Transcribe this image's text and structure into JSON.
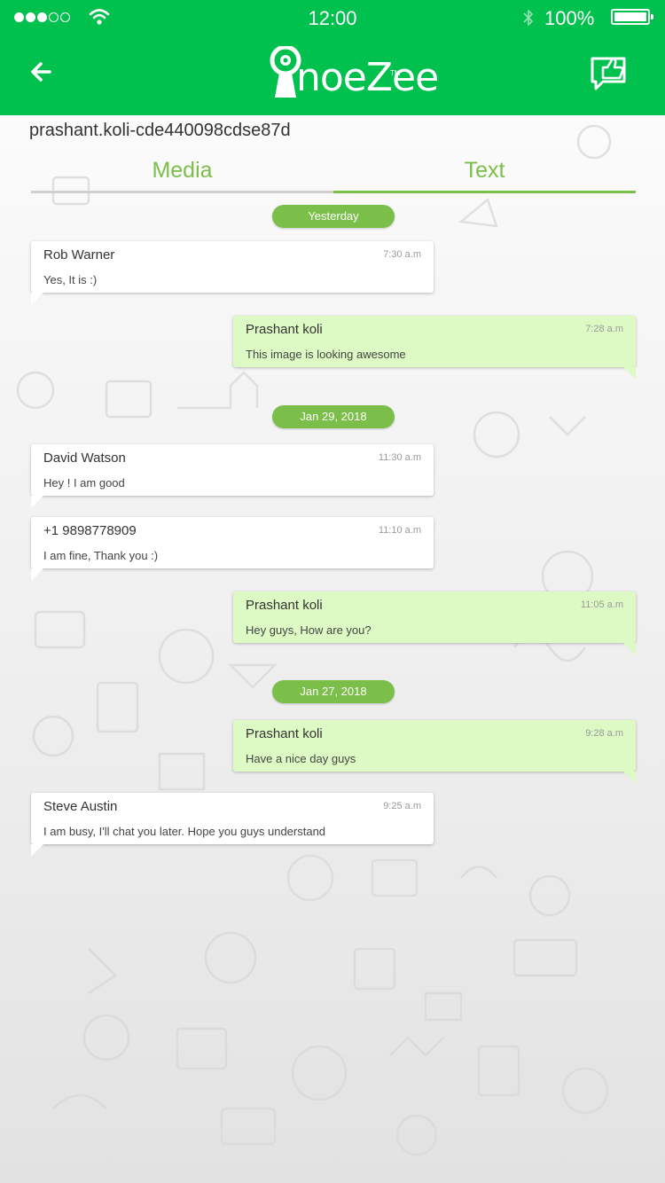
{
  "status_bar": {
    "time": "12:00",
    "battery": "100%",
    "signal_icon": "signal-dots-icon",
    "wifi_icon": "wifi-icon",
    "bluetooth_icon": "bluetooth-icon"
  },
  "header": {
    "logo_text": "noeZee",
    "logo_tm": "TM",
    "back_icon": "arrow-left-icon",
    "feedback_icon": "thumbs-up-chat-icon",
    "background_color": "#00c14d"
  },
  "chat_id": "prashant.koli-cde440098cdse87d",
  "tabs": [
    {
      "label": "Media",
      "active": false
    },
    {
      "label": "Text",
      "active": true
    }
  ],
  "accent_color": "#7cbe4a",
  "dates": [
    "Yesterday",
    "Jan 29, 2018",
    "Jan 27, 2018"
  ],
  "messages": [
    {
      "sender": "Rob Warner",
      "time": "7:30 a.m",
      "text": "Yes, It is :)",
      "direction": "incoming"
    },
    {
      "sender": "Prashant koli",
      "time": "7:28 a.m",
      "text": "This image is looking awesome",
      "direction": "outgoing"
    },
    {
      "sender": "David Watson",
      "time": "11:30 a.m",
      "text": "Hey ! I am good",
      "direction": "incoming"
    },
    {
      "sender": "+1 9898778909",
      "time": "11:10 a.m",
      "text": "I am fine, Thank you :)",
      "direction": "incoming"
    },
    {
      "sender": "Prashant koli",
      "time": "11:05 a.m",
      "text": "Hey guys, How are you?",
      "direction": "outgoing"
    },
    {
      "sender": "Prashant koli",
      "time": "9:28 a.m",
      "text": "Have a nice day guys",
      "direction": "outgoing"
    },
    {
      "sender": "Steve Austin",
      "time": "9:25 a.m",
      "text": "I am busy, I'll chat you later. Hope you guys understand",
      "direction": "incoming"
    }
  ]
}
